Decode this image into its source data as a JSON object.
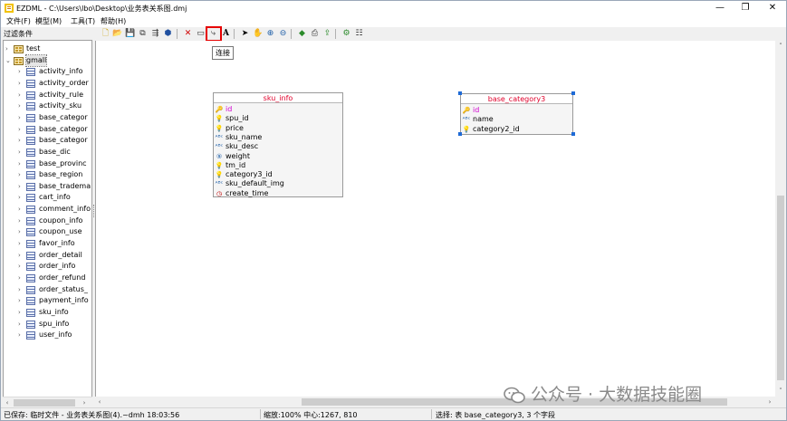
{
  "window": {
    "title": "EZDML - C:\\Users\\lbo\\Desktop\\业务表关系图.dmj",
    "controls": {
      "minimize": "—",
      "maximize": "❐",
      "close": "✕"
    }
  },
  "menu": [
    "文件(F)",
    "模型(M)",
    "工具(T)",
    "帮助(H)"
  ],
  "left_panel": {
    "filter_label": "过滤条件",
    "tree": [
      {
        "label": "test",
        "level": 0,
        "type": "db",
        "expanded": false
      },
      {
        "label": "gmall",
        "level": 0,
        "type": "db",
        "expanded": true,
        "selected": true
      },
      {
        "label": "activity_info",
        "level": 1,
        "type": "table"
      },
      {
        "label": "activity_order",
        "level": 1,
        "type": "table"
      },
      {
        "label": "activity_rule",
        "level": 1,
        "type": "table"
      },
      {
        "label": "activity_sku",
        "level": 1,
        "type": "table"
      },
      {
        "label": "base_categor",
        "level": 1,
        "type": "table"
      },
      {
        "label": "base_categor",
        "level": 1,
        "type": "table"
      },
      {
        "label": "base_categor",
        "level": 1,
        "type": "table"
      },
      {
        "label": "base_dic",
        "level": 1,
        "type": "table"
      },
      {
        "label": "base_provinc",
        "level": 1,
        "type": "table"
      },
      {
        "label": "base_region",
        "level": 1,
        "type": "table"
      },
      {
        "label": "base_tradema",
        "level": 1,
        "type": "table"
      },
      {
        "label": "cart_info",
        "level": 1,
        "type": "table"
      },
      {
        "label": "comment_info",
        "level": 1,
        "type": "table"
      },
      {
        "label": "coupon_info",
        "level": 1,
        "type": "table"
      },
      {
        "label": "coupon_use",
        "level": 1,
        "type": "table"
      },
      {
        "label": "favor_info",
        "level": 1,
        "type": "table"
      },
      {
        "label": "order_detail",
        "level": 1,
        "type": "table"
      },
      {
        "label": "order_info",
        "level": 1,
        "type": "table"
      },
      {
        "label": "order_refund",
        "level": 1,
        "type": "table"
      },
      {
        "label": "order_status_",
        "level": 1,
        "type": "table"
      },
      {
        "label": "payment_info",
        "level": 1,
        "type": "table"
      },
      {
        "label": "sku_info",
        "level": 1,
        "type": "table"
      },
      {
        "label": "spu_info",
        "level": 1,
        "type": "table"
      },
      {
        "label": "user_info",
        "level": 1,
        "type": "table"
      }
    ]
  },
  "toolbar": {
    "buttons": [
      {
        "name": "new-icon",
        "glyph": "🗋",
        "color": "#c8a000"
      },
      {
        "name": "open-icon",
        "glyph": "📂",
        "color": "#d8a000"
      },
      {
        "name": "save-icon",
        "glyph": "💾",
        "color": "#2a4e9c"
      },
      {
        "name": "copy-icon",
        "glyph": "⧉",
        "color": "#333333"
      },
      {
        "name": "layout-icon",
        "glyph": "⇶",
        "color": "#333333"
      },
      {
        "name": "import-icon",
        "glyph": "⬢",
        "color": "#2050a0"
      },
      {
        "name": "delete-icon",
        "glyph": "✕",
        "color": "#d00000"
      },
      {
        "name": "table-icon",
        "glyph": "▭",
        "color": "#333333"
      },
      {
        "name": "link-icon",
        "glyph": "⤷",
        "color": "#333333"
      },
      {
        "name": "text-icon",
        "glyph": "A",
        "color": "#000000"
      },
      {
        "name": "pointer-icon",
        "glyph": "➤",
        "color": "#000000"
      },
      {
        "name": "hand-icon",
        "glyph": "✋",
        "color": "#333333"
      },
      {
        "name": "zoom-in-icon",
        "glyph": "⊕",
        "color": "#1f5fa8"
      },
      {
        "name": "zoom-out-icon",
        "glyph": "⊖",
        "color": "#1f5fa8"
      },
      {
        "name": "color-icon",
        "glyph": "◆",
        "color": "#2a8a2a"
      },
      {
        "name": "print-icon",
        "glyph": "⎙",
        "color": "#333333"
      },
      {
        "name": "export-icon",
        "glyph": "⇪",
        "color": "#2a8a2a"
      },
      {
        "name": "generate-icon",
        "glyph": "⚙",
        "color": "#2a8a2a"
      },
      {
        "name": "settings-icon",
        "glyph": "☷",
        "color": "#333333"
      }
    ],
    "tooltip": "连接"
  },
  "entities": [
    {
      "title": "sku_info",
      "fields": [
        {
          "name": "id",
          "icon": "key",
          "pk": true
        },
        {
          "name": "spu_id",
          "icon": "bulb"
        },
        {
          "name": "price",
          "icon": "bulb"
        },
        {
          "name": "sku_name",
          "icon": "text"
        },
        {
          "name": "sku_desc",
          "icon": "text"
        },
        {
          "name": "weight",
          "icon": "num"
        },
        {
          "name": "tm_id",
          "icon": "bulb"
        },
        {
          "name": "category3_id",
          "icon": "bulb"
        },
        {
          "name": "sku_default_img",
          "icon": "text"
        },
        {
          "name": "create_time",
          "icon": "clock"
        }
      ]
    },
    {
      "title": "base_category3",
      "selected": true,
      "fields": [
        {
          "name": "id",
          "icon": "key",
          "pk": true
        },
        {
          "name": "name",
          "icon": "text"
        },
        {
          "name": "category2_id",
          "icon": "bulb"
        }
      ]
    }
  ],
  "status": {
    "saved": "已保存: 临时文件 - 业务表关系图(4).~dmh 18:03:56",
    "zoom": "缩放:100% 中心:1267, 810",
    "selection": "选择: 表 base_category3, 3 个字段"
  },
  "watermark": "公众号 · 大数据技能圈",
  "colors": {
    "entity_title": "#e0002b",
    "pk_field": "#d000d0",
    "highlight": "#e60000",
    "handle": "#1e6ad6"
  }
}
